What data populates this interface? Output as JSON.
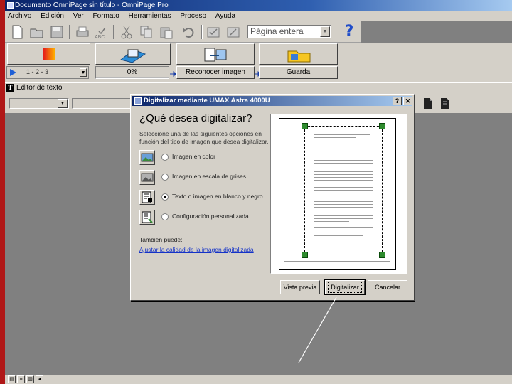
{
  "window": {
    "title": "Documento OmniPage sin título - OmniPage Pro"
  },
  "menu": [
    "Archivo",
    "Edición",
    "Ver",
    "Formato",
    "Herramientas",
    "Proceso",
    "Ayuda"
  ],
  "toolbar": {
    "page_view": "Página entera"
  },
  "workflow": {
    "scan_option": "1 - 2 - 3",
    "progress_label": "0%",
    "progress": 0,
    "recognize_label": "Reconocer imagen",
    "save_label": "Guarda"
  },
  "editor": {
    "title": "Editor de texto"
  },
  "dialog": {
    "title": "Digitalizar mediante UMAX Astra 4000U",
    "help_btn": "?",
    "close_btn": "✕",
    "heading": "¿Qué desea digitalizar?",
    "instructions": "Seleccione una de las siguientes opciones en función del tipo de imagen que desea digitalizar.",
    "options": [
      {
        "label": "Imagen en color",
        "selected": false
      },
      {
        "label": "Imagen en escala de grises",
        "selected": false
      },
      {
        "label": "Texto o imagen en blanco y negro",
        "selected": true
      },
      {
        "label": "Configuración personalizada",
        "selected": false
      }
    ],
    "also_can": "También puede:",
    "adjust_link": "Ajustar la calidad de la imagen digitalizada",
    "buttons": {
      "preview": "Vista previa",
      "scan": "Digitalizar",
      "cancel": "Cancelar"
    }
  }
}
